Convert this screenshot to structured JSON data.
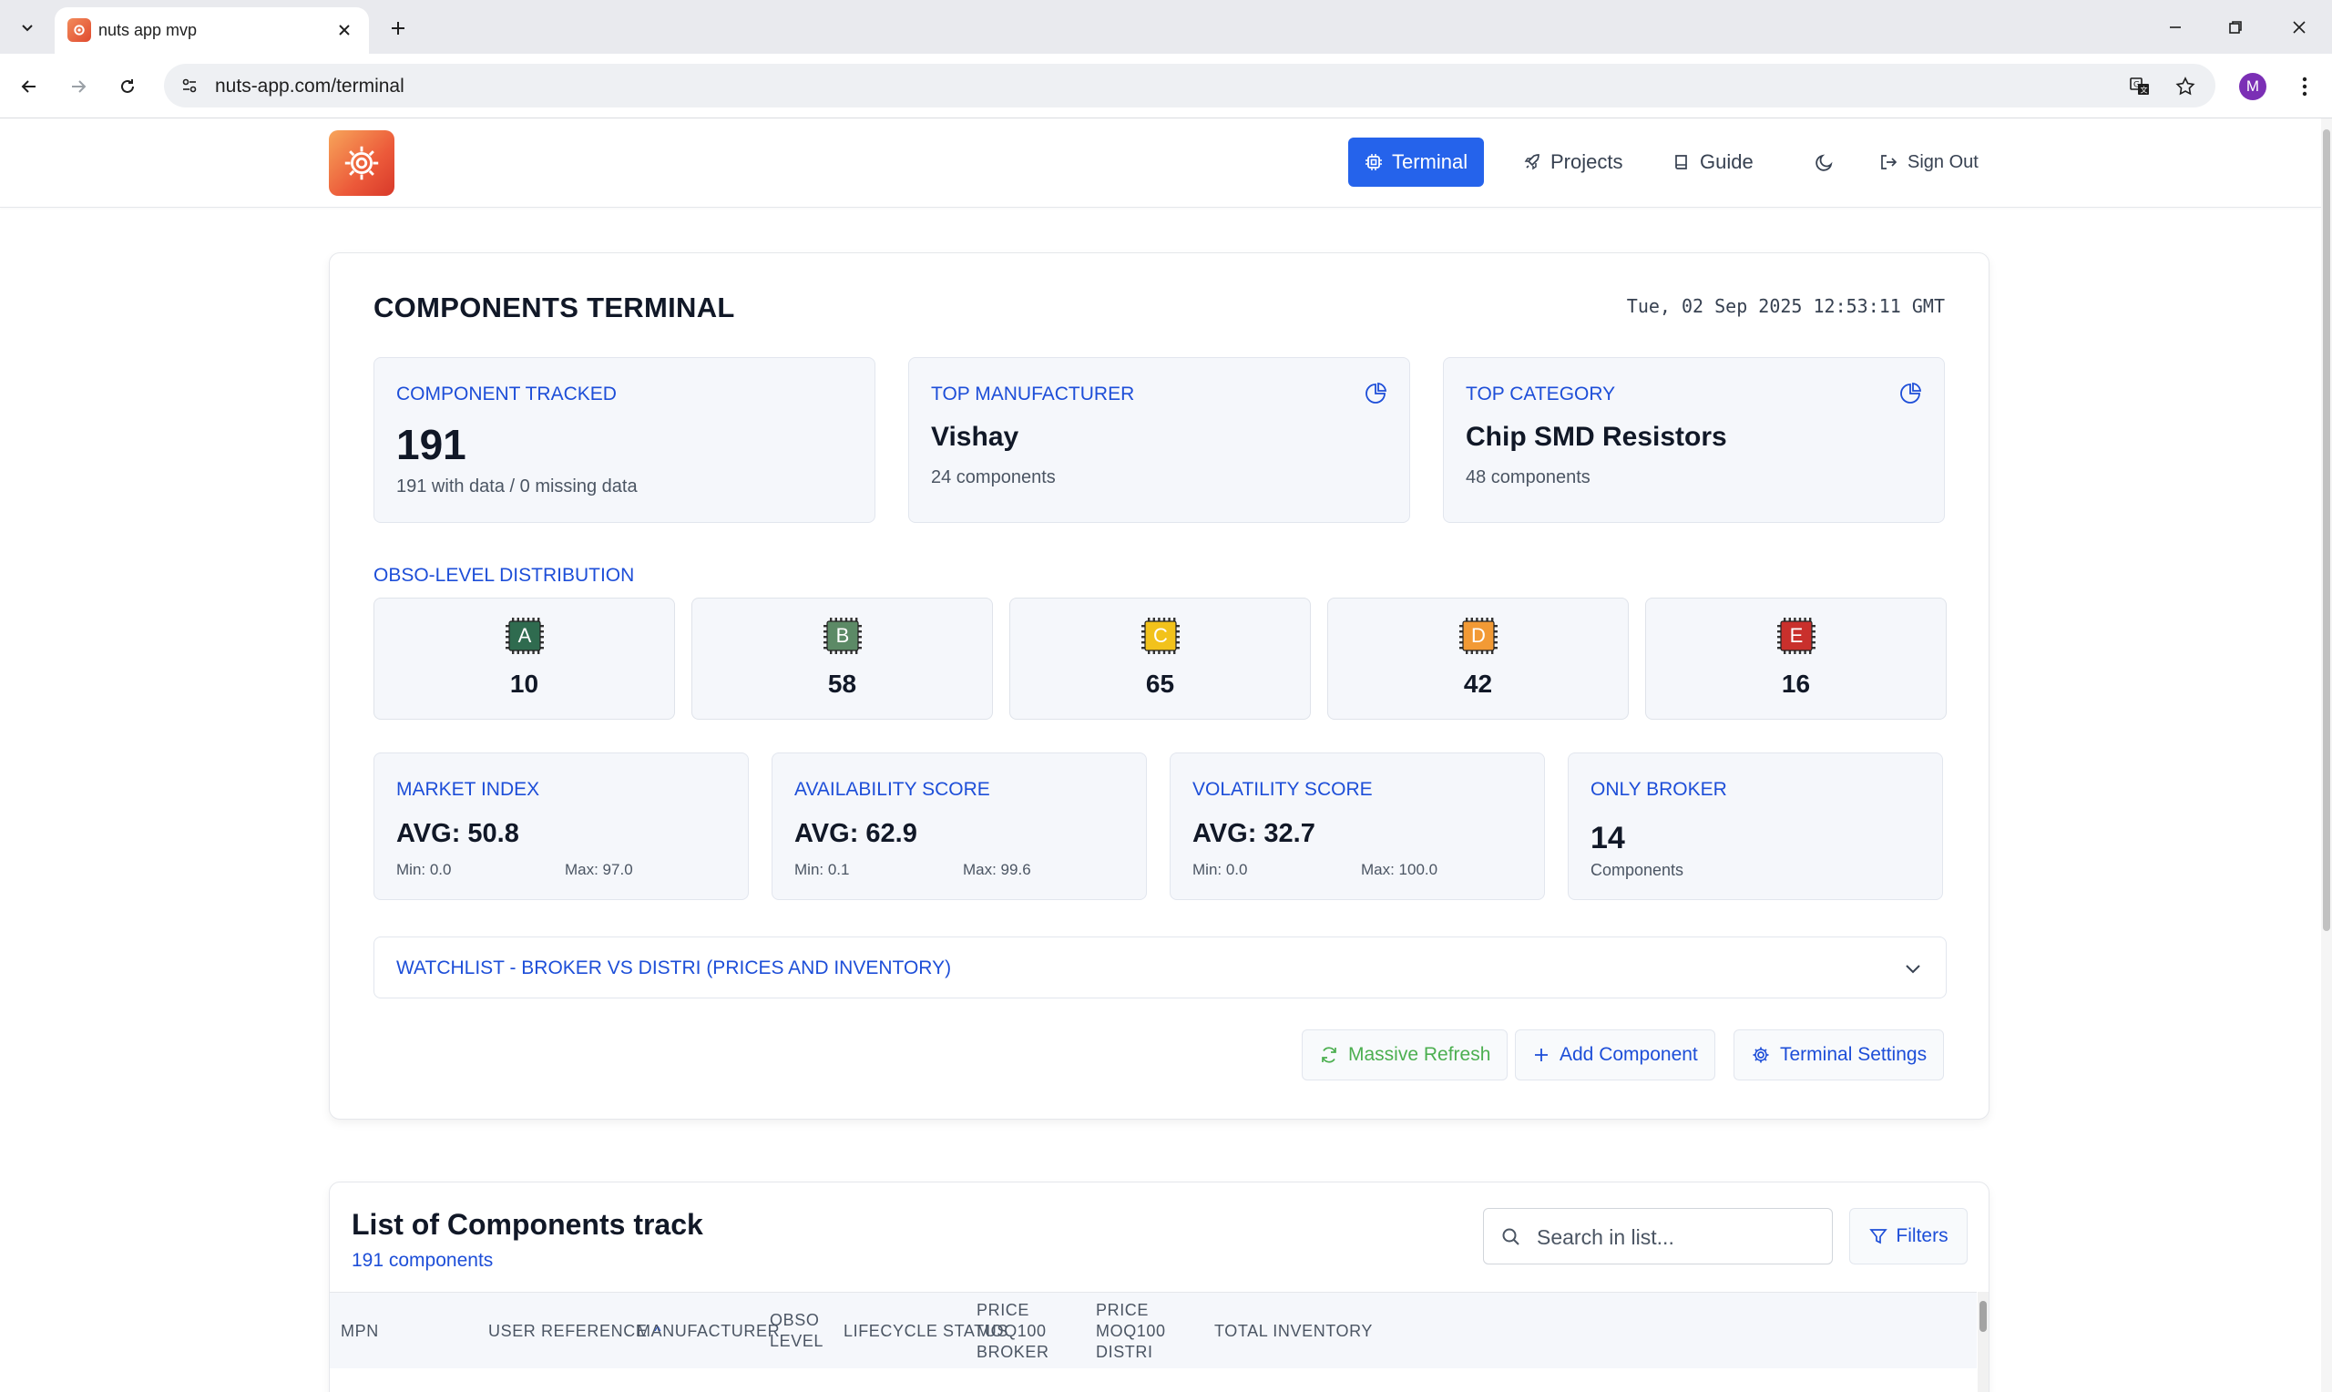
{
  "browser": {
    "tab_title": "nuts app mvp",
    "url": "nuts-app.com/terminal",
    "profile_initial": "M"
  },
  "nav": {
    "items": [
      {
        "label": "Terminal",
        "icon": "cpu-icon",
        "active": true
      },
      {
        "label": "Projects",
        "icon": "rocket-icon",
        "active": false
      },
      {
        "label": "Guide",
        "icon": "book-icon",
        "active": false
      },
      {
        "label": "",
        "icon": "moon-icon",
        "active": false
      },
      {
        "label": "Sign Out",
        "icon": "sign-out-icon",
        "active": false
      }
    ]
  },
  "terminal": {
    "title": "COMPONENTS TERMINAL",
    "timestamp": "Tue, 02 Sep 2025 12:53:11 GMT",
    "stats": {
      "tracked": {
        "label": "COMPONENT TRACKED",
        "value": "191",
        "sub": "191 with data / 0 missing data"
      },
      "manufacturer": {
        "label": "TOP MANUFACTURER",
        "value": "Vishay",
        "sub": "24 components"
      },
      "category": {
        "label": "TOP CATEGORY",
        "value": "Chip SMD Resistors",
        "sub": "48 components"
      }
    },
    "obso_label": "OBSO-LEVEL DISTRIBUTION",
    "obso": [
      {
        "letter": "A",
        "count": "10",
        "color": "#2f6b4f"
      },
      {
        "letter": "B",
        "count": "58",
        "color": "#5c8a66"
      },
      {
        "letter": "C",
        "count": "65",
        "color": "#f2c21b"
      },
      {
        "letter": "D",
        "count": "42",
        "color": "#f29a35"
      },
      {
        "letter": "E",
        "count": "16",
        "color": "#c9302c"
      }
    ],
    "metrics": {
      "market": {
        "label": "MARKET INDEX",
        "avg": "AVG: 50.8",
        "min": "Min: 0.0",
        "max": "Max: 97.0"
      },
      "availability": {
        "label": "AVAILABILITY SCORE",
        "avg": "AVG: 62.9",
        "min": "Min: 0.1",
        "max": "Max: 99.6"
      },
      "volatility": {
        "label": "VOLATILITY SCORE",
        "avg": "AVG: 32.7",
        "min": "Min: 0.0",
        "max": "Max: 100.0"
      },
      "broker": {
        "label": "ONLY BROKER",
        "value": "14",
        "sub": "Components"
      }
    },
    "watchlist_label": "WATCHLIST - BROKER VS DISTRI (PRICES AND INVENTORY)",
    "actions": {
      "refresh": "Massive Refresh",
      "add": "Add Component",
      "settings": "Terminal Settings"
    }
  },
  "list": {
    "title": "List of Components track",
    "count": "191 components",
    "search_placeholder": "Search in list...",
    "filters_label": "Filters",
    "columns": {
      "mpn": "MPN",
      "user_reference": "USER REFERENCE",
      "manufacturer": "MANUFACTURER",
      "obso_level": "OBSO LEVEL",
      "lifecycle": "LIFECYCLE STATUS",
      "price_broker": "PRICE MOQ100 BROKER",
      "price_distri": "PRICE MOQ100 DISTRI",
      "inventory": "TOTAL INVENTORY"
    },
    "sort_indicator": "^"
  },
  "colors": {
    "accent": "#2563eb",
    "label_blue": "#1d4ed8",
    "refresh_green": "#4caf50"
  }
}
